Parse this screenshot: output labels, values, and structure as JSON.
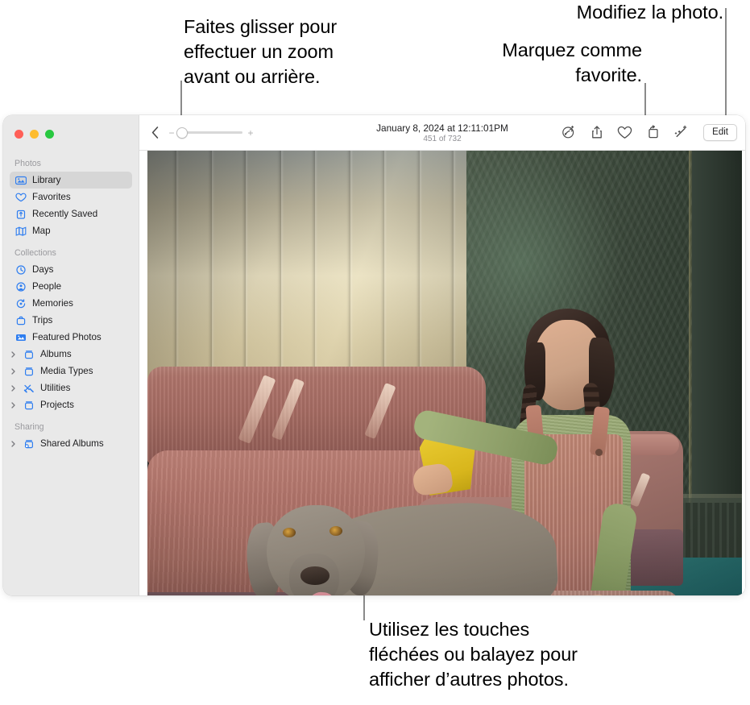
{
  "callouts": [
    {
      "id": "zoom",
      "text": "Faites glisser pour\neffectuer un zoom\navant ou arrière."
    },
    {
      "id": "fav",
      "text": "Marquez comme\nfavorite."
    },
    {
      "id": "edit",
      "text": "Modifiez la photo."
    },
    {
      "id": "arrows",
      "text": "Utilisez les touches\nfléchées ou balayez pour\nafficher d’autres photos."
    }
  ],
  "window": {
    "traffic_lights": [
      "close",
      "minimize",
      "zoom"
    ]
  },
  "sidebar": {
    "groups": [
      {
        "title": "Photos",
        "items": [
          {
            "label": "Library",
            "icon": "library-icon",
            "selected": true,
            "disclosure": false
          },
          {
            "label": "Favorites",
            "icon": "heart-icon",
            "selected": false,
            "disclosure": false
          },
          {
            "label": "Recently Saved",
            "icon": "recently-saved-icon",
            "selected": false,
            "disclosure": false
          },
          {
            "label": "Map",
            "icon": "map-icon",
            "selected": false,
            "disclosure": false
          }
        ]
      },
      {
        "title": "Collections",
        "items": [
          {
            "label": "Days",
            "icon": "clock-icon",
            "selected": false,
            "disclosure": false
          },
          {
            "label": "People",
            "icon": "person-icon",
            "selected": false,
            "disclosure": false
          },
          {
            "label": "Memories",
            "icon": "memories-icon",
            "selected": false,
            "disclosure": false
          },
          {
            "label": "Trips",
            "icon": "trips-icon",
            "selected": false,
            "disclosure": false
          },
          {
            "label": "Featured Photos",
            "icon": "featured-photos-icon",
            "selected": false,
            "disclosure": false
          },
          {
            "label": "Albums",
            "icon": "album-icon",
            "selected": false,
            "disclosure": true
          },
          {
            "label": "Media Types",
            "icon": "album-icon",
            "selected": false,
            "disclosure": true
          },
          {
            "label": "Utilities",
            "icon": "utilities-icon",
            "selected": false,
            "disclosure": true
          },
          {
            "label": "Projects",
            "icon": "album-icon",
            "selected": false,
            "disclosure": true
          }
        ]
      },
      {
        "title": "Sharing",
        "items": [
          {
            "label": "Shared Albums",
            "icon": "shared-album-icon",
            "selected": false,
            "disclosure": true
          }
        ]
      }
    ]
  },
  "toolbar": {
    "back_icon": "chevron-left-icon",
    "zoom_out_label": "−",
    "zoom_in_label": "+",
    "zoom_slider_value": 4,
    "title": "January 8, 2024 at 12:11:01PM",
    "subtitle": "451 of 732",
    "actions": [
      {
        "name": "pet-info-icon",
        "label": ""
      },
      {
        "name": "share-icon",
        "label": ""
      },
      {
        "name": "heart-icon",
        "label": ""
      },
      {
        "name": "rotate-icon",
        "label": ""
      },
      {
        "name": "magic-wand-icon",
        "label": ""
      }
    ],
    "edit_label": "Edit"
  },
  "photo": {
    "alt": "Girl in green shirt and rust corduroy overalls petting a grey Weimaraner dog on a pink couch with yellow blanket",
    "accent": "#2f7ef0"
  }
}
